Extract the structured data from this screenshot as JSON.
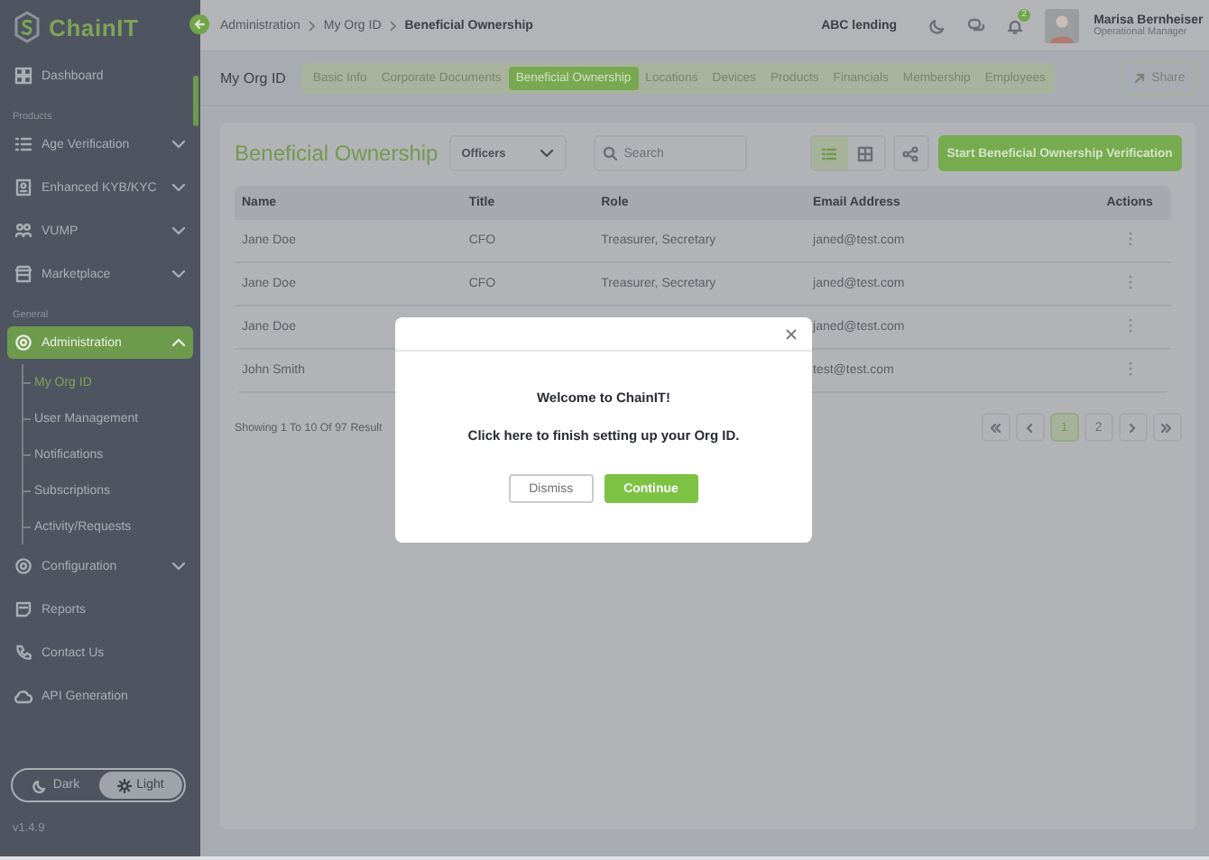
{
  "sidebar": {
    "logo": "ChainIT",
    "items": [
      {
        "kind": "item",
        "label": "Dashboard",
        "selected": false
      },
      {
        "kind": "section",
        "label": "Products"
      },
      {
        "kind": "item",
        "label": "Age Verification",
        "selected": false,
        "expanded": false
      },
      {
        "kind": "item",
        "label": "Enhanced KYB/KYC",
        "selected": false,
        "expanded": false
      },
      {
        "kind": "item",
        "label": "VUMP",
        "selected": false,
        "expanded": false
      },
      {
        "kind": "item",
        "label": "Marketplace",
        "selected": false,
        "expanded": false
      },
      {
        "kind": "section",
        "label": "General"
      },
      {
        "kind": "item",
        "label": "Administration",
        "selected": true,
        "expanded": true,
        "children": [
          {
            "label": "My Org ID",
            "selected": true
          },
          {
            "label": "User Management",
            "selected": false
          },
          {
            "label": "Notifications",
            "selected": false
          },
          {
            "label": "Subscriptions",
            "selected": false
          },
          {
            "label": "Activity/Requests",
            "selected": false
          }
        ]
      },
      {
        "kind": "item",
        "label": "Configuration",
        "selected": false,
        "expanded": false
      },
      {
        "kind": "item",
        "label": "Reports",
        "selected": false
      },
      {
        "kind": "item",
        "label": "Contact Us",
        "selected": false
      },
      {
        "kind": "item",
        "label": "API Generation",
        "selected": false
      }
    ],
    "theme_toggle": [
      {
        "label": "Dark",
        "selected": false
      },
      {
        "label": "Light",
        "selected": true
      }
    ],
    "version": "v1.4.9"
  },
  "topbar": {
    "breadcrumbs": [
      "Administration",
      "My Org ID",
      "Beneficial Ownership"
    ],
    "organization": "ABC lending",
    "notification_count": "2",
    "user": {
      "name": "Marisa Bernheiser",
      "role": "Operational Manager"
    }
  },
  "page_header": {
    "title": "My Org ID",
    "tabs": [
      {
        "label": "Basic Info",
        "selected": false
      },
      {
        "label": "Corporate Documents",
        "selected": false
      },
      {
        "label": "Beneficial Ownership",
        "selected": true
      },
      {
        "label": "Locations",
        "selected": false
      },
      {
        "label": "Devices",
        "selected": false
      },
      {
        "label": "Products",
        "selected": false
      },
      {
        "label": "Financials",
        "selected": false
      },
      {
        "label": "Membership",
        "selected": false
      },
      {
        "label": "Employees",
        "selected": false
      }
    ],
    "share_button": "Share"
  },
  "card": {
    "title": "Beneficial Ownership",
    "filter": {
      "value": "Officers"
    },
    "search": {
      "placeholder": "Search"
    },
    "views": [
      {
        "kind": "list",
        "selected": true
      },
      {
        "kind": "grid",
        "selected": false
      }
    ],
    "action_button": "Start Beneficial Ownership Verification",
    "table": {
      "columns": [
        "Name",
        "Title",
        "Role",
        "Email Address",
        "Actions"
      ],
      "rows": [
        {
          "cells": [
            "Jane Doe",
            "CFO",
            "Treasurer, Secretary",
            "janed@test.com"
          ]
        },
        {
          "cells": [
            "Jane Doe",
            "CFO",
            "Treasurer, Secretary",
            "janed@test.com"
          ]
        },
        {
          "cells": [
            "Jane Doe",
            null,
            null,
            "janed@test.com"
          ]
        },
        {
          "cells": [
            "John Smith",
            null,
            null,
            "test@test.com"
          ]
        }
      ]
    },
    "summary": "Showing 1 To 10 Of 97 Result",
    "pagination": {
      "pages": [
        {
          "label": "1",
          "selected": true
        },
        {
          "label": "2",
          "selected": false
        }
      ]
    }
  },
  "modal": {
    "title": "Welcome to ChainIT!",
    "message": "Click here to finish setting up your Org ID.",
    "buttons": [
      {
        "label": "Dismiss",
        "kind": "secondary"
      },
      {
        "label": "Continue",
        "kind": "primary"
      }
    ]
  }
}
